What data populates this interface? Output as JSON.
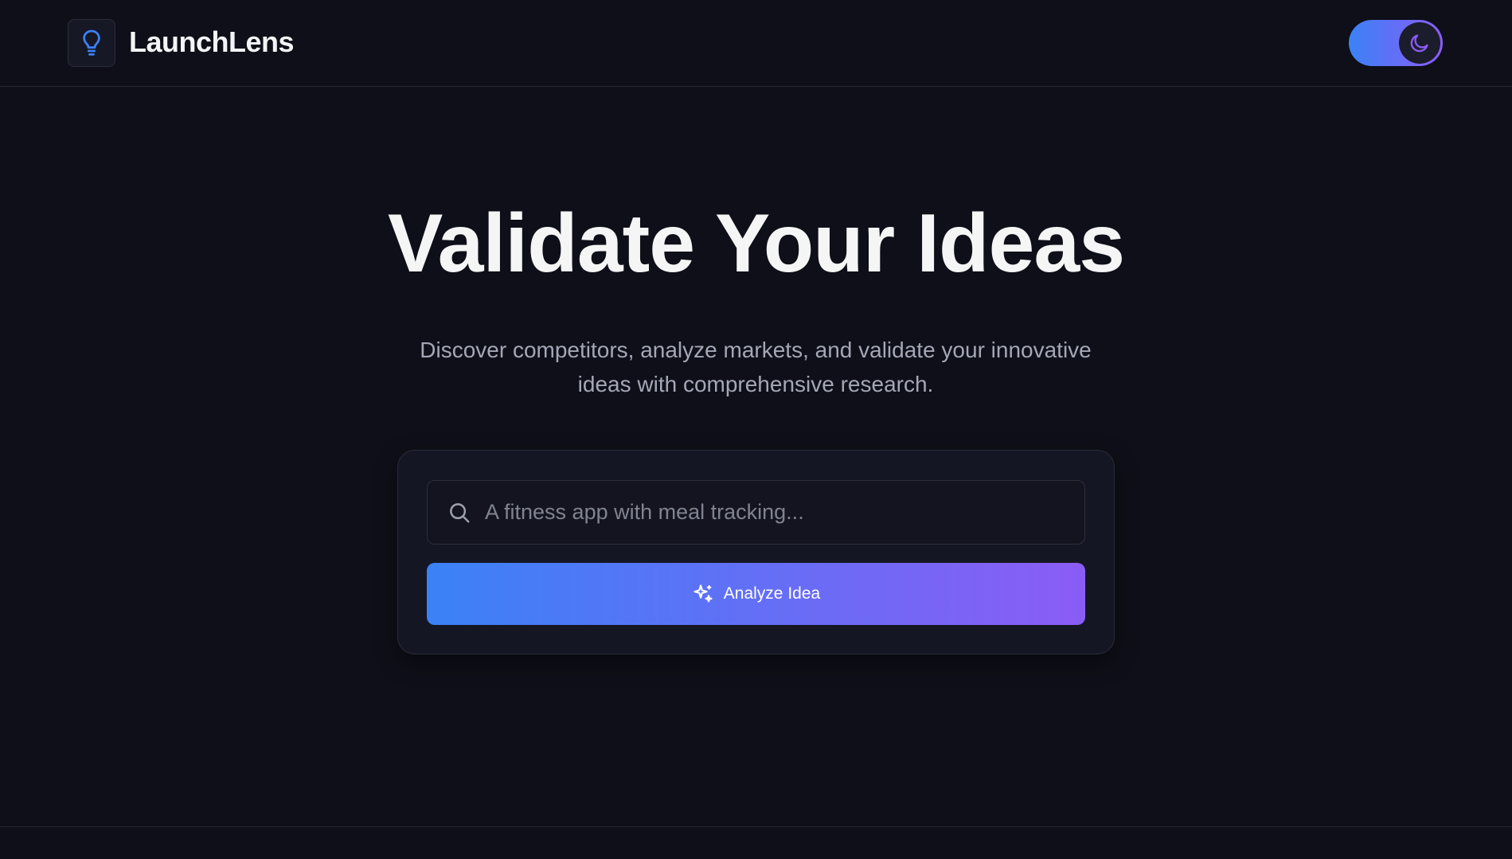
{
  "header": {
    "brand": "LaunchLens",
    "logo_icon": "lightbulb-icon",
    "theme_toggle": {
      "state": "dark",
      "icon": "moon-icon"
    }
  },
  "hero": {
    "title": "Validate Your Ideas",
    "subtitle_line1": "Discover competitors, analyze markets, and validate your innovative",
    "subtitle_line2": "ideas with comprehensive research."
  },
  "search": {
    "placeholder": "A fitness app with meal tracking...",
    "value": "",
    "icon": "search-icon"
  },
  "analyze_button": {
    "label": "Analyze Idea",
    "icon": "sparkles-icon"
  },
  "colors": {
    "background": "#0e0f18",
    "accent_start": "#3b82f6",
    "accent_end": "#8b5cf6",
    "logo_icon": "#3b82f6",
    "moon_icon": "#8b5cf6"
  }
}
